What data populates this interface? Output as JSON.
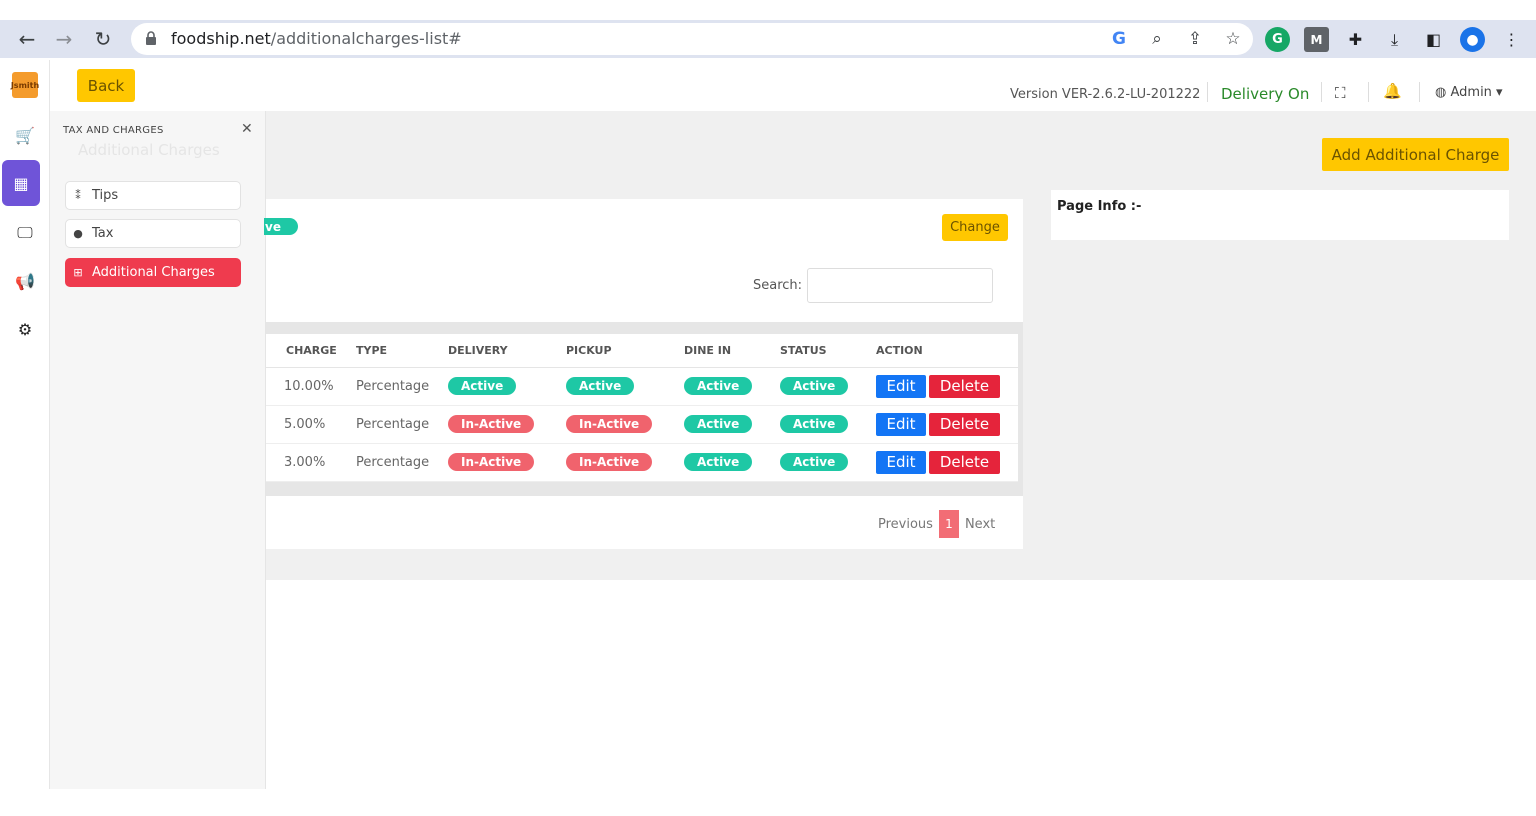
{
  "browser": {
    "url_domain": "foodship.net",
    "url_path": "/additionalcharges-list#"
  },
  "app": {
    "logo_text": "Jsmith",
    "back_label": "Back",
    "version_text": "Version VER-2.6.2-LU-201222",
    "delivery_status": "Delivery On",
    "admin_label": "Admin ▾"
  },
  "panel": {
    "title": "TAX AND CHARGES",
    "ghost_title": "Additional Charges",
    "items": [
      {
        "label": "Tips",
        "icon": "tips-icon"
      },
      {
        "label": "Tax",
        "icon": "tax-icon"
      },
      {
        "label": "Additional Charges",
        "icon": "plus-square-icon"
      }
    ]
  },
  "main": {
    "badge_peek": "ve",
    "change_label": "Change",
    "search_label": "Search:",
    "add_label": "Add Additional Charge",
    "page_info": "Page Info :-",
    "columns": [
      "CHARGE",
      "TYPE",
      "DELIVERY",
      "PICKUP",
      "DINE IN",
      "STATUS",
      "ACTION"
    ],
    "rows": [
      {
        "charge": "10.00%",
        "type": "Percentage",
        "delivery": "Active",
        "pickup": "Active",
        "dine_in": "Active",
        "status": "Active"
      },
      {
        "charge": "5.00%",
        "type": "Percentage",
        "delivery": "In-Active",
        "pickup": "In-Active",
        "dine_in": "Active",
        "status": "Active"
      },
      {
        "charge": "3.00%",
        "type": "Percentage",
        "delivery": "In-Active",
        "pickup": "In-Active",
        "dine_in": "Active",
        "status": "Active"
      }
    ],
    "edit_label": "Edit",
    "delete_label": "Delete",
    "pagination": {
      "previous": "Previous",
      "current": "1",
      "next": "Next"
    }
  }
}
